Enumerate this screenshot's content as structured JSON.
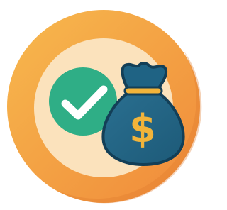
{
  "icon": {
    "name": "payment-approved-icon",
    "parts": [
      "outer-ring",
      "inner-disc",
      "check-badge",
      "money-bag",
      "dollar-sign"
    ],
    "colors": {
      "ring_light": "#f7b94e",
      "ring_dark": "#f08a3a",
      "inner_disc": "#fbe2bc",
      "check_badge": "#2fae86",
      "check_mark": "#ffffff",
      "bag_body": "#1d5a78",
      "bag_outline": "#133f57",
      "bag_tie": "#f2b43a",
      "dollar": "#f2b43a"
    },
    "dollar_glyph": "$"
  }
}
